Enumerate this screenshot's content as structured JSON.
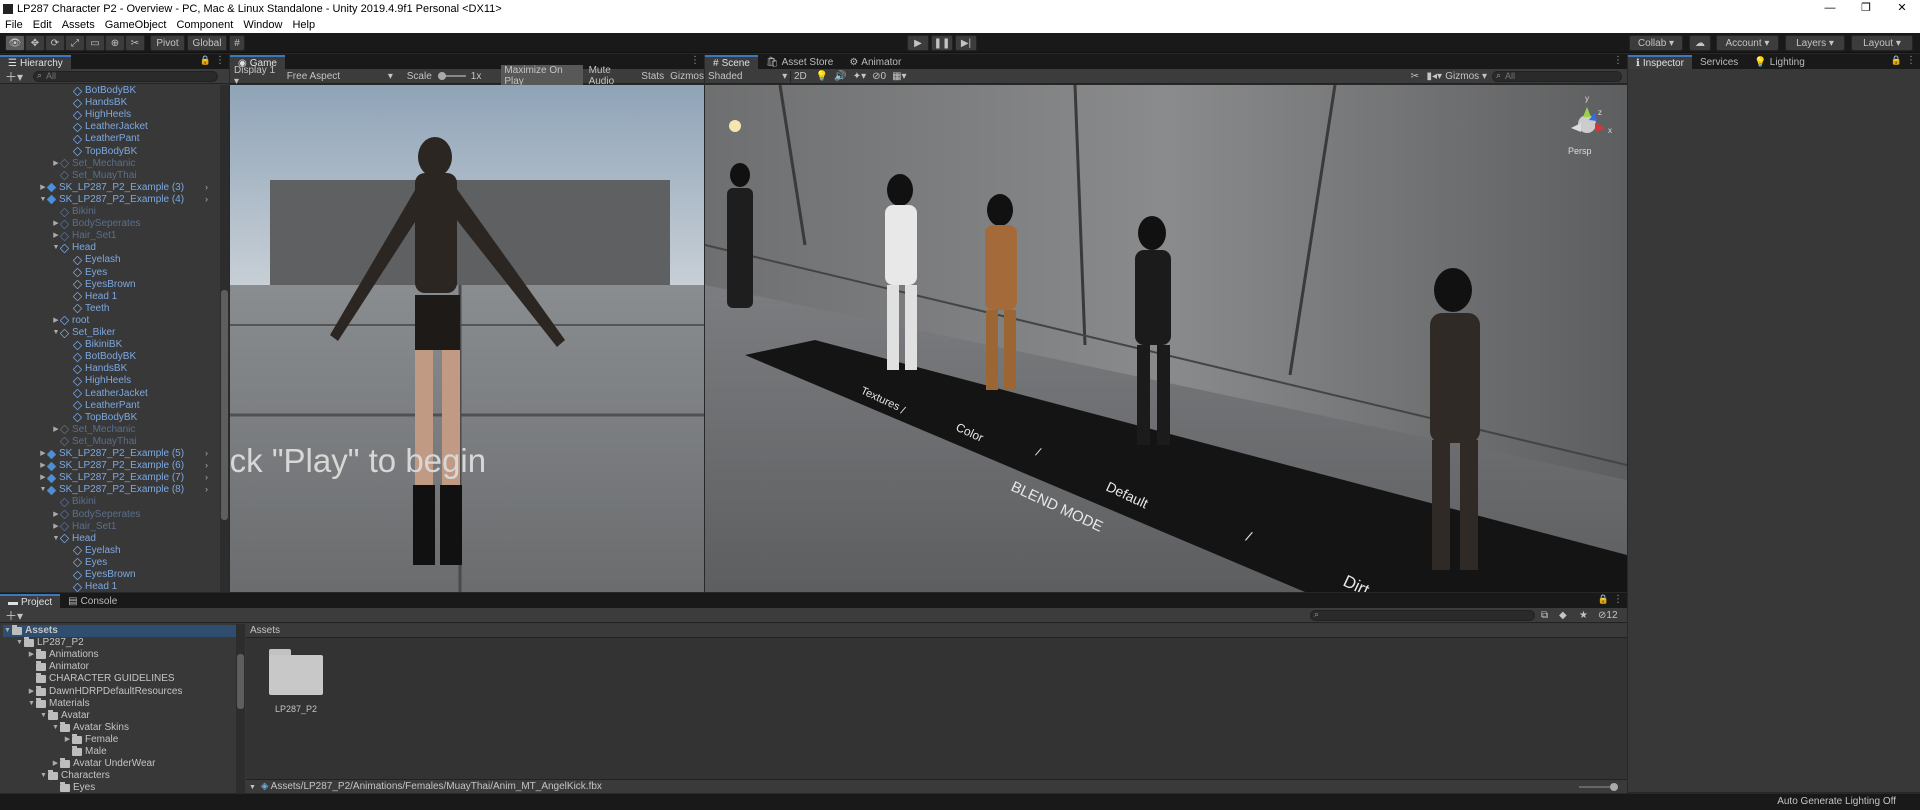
{
  "window": {
    "title": "LP287 Character P2 - Overview - PC, Mac & Linux Standalone - Unity 2019.4.9f1 Personal <DX11>"
  },
  "menu": [
    "File",
    "Edit",
    "Assets",
    "GameObject",
    "Component",
    "Window",
    "Help"
  ],
  "toolbar": {
    "pivot": "Pivot",
    "global": "Global",
    "collab": "Collab ▾",
    "account": "Account",
    "layers": "Layers",
    "layout": "Layout"
  },
  "hierarchy": {
    "tab": "Hierarchy",
    "search_placeholder": "All",
    "rows": [
      {
        "label": "BotBodyBK",
        "indent": 3,
        "arrow": "",
        "style": "prefab"
      },
      {
        "label": "HandsBK",
        "indent": 3,
        "arrow": "",
        "style": "prefab"
      },
      {
        "label": "HighHeels",
        "indent": 3,
        "arrow": "",
        "style": "prefab"
      },
      {
        "label": "LeatherJacket",
        "indent": 3,
        "arrow": "",
        "style": "prefab"
      },
      {
        "label": "LeatherPant",
        "indent": 3,
        "arrow": "",
        "style": "prefab"
      },
      {
        "label": "TopBodyBK",
        "indent": 3,
        "arrow": "",
        "style": "prefab"
      },
      {
        "label": "Set_Mechanic",
        "indent": 2,
        "arrow": "▶",
        "style": "disabled"
      },
      {
        "label": "Set_MuayThai",
        "indent": 2,
        "arrow": "",
        "style": "disabled"
      },
      {
        "label": "SK_LP287_P2_Example (3)",
        "indent": 1,
        "arrow": "▶",
        "style": "prefab-root",
        "chev": true
      },
      {
        "label": "SK_LP287_P2_Example (4)",
        "indent": 1,
        "arrow": "▼",
        "style": "prefab-root",
        "chev": true
      },
      {
        "label": "Bikini",
        "indent": 2,
        "arrow": "",
        "style": "disabled"
      },
      {
        "label": "BodySeperates",
        "indent": 2,
        "arrow": "▶",
        "style": "disabled"
      },
      {
        "label": "Hair_Set1",
        "indent": 2,
        "arrow": "▶",
        "style": "disabled"
      },
      {
        "label": "Head",
        "indent": 2,
        "arrow": "▼",
        "style": "prefab"
      },
      {
        "label": "Eyelash",
        "indent": 3,
        "arrow": "",
        "style": "prefab"
      },
      {
        "label": "Eyes",
        "indent": 3,
        "arrow": "",
        "style": "prefab"
      },
      {
        "label": "EyesBrown",
        "indent": 3,
        "arrow": "",
        "style": "prefab"
      },
      {
        "label": "Head 1",
        "indent": 3,
        "arrow": "",
        "style": "prefab"
      },
      {
        "label": "Teeth",
        "indent": 3,
        "arrow": "",
        "style": "prefab"
      },
      {
        "label": "root",
        "indent": 2,
        "arrow": "▶",
        "style": "prefab"
      },
      {
        "label": "Set_Biker",
        "indent": 2,
        "arrow": "▼",
        "style": "prefab"
      },
      {
        "label": "BikiniBK",
        "indent": 3,
        "arrow": "",
        "style": "prefab"
      },
      {
        "label": "BotBodyBK",
        "indent": 3,
        "arrow": "",
        "style": "prefab"
      },
      {
        "label": "HandsBK",
        "indent": 3,
        "arrow": "",
        "style": "prefab"
      },
      {
        "label": "HighHeels",
        "indent": 3,
        "arrow": "",
        "style": "prefab"
      },
      {
        "label": "LeatherJacket",
        "indent": 3,
        "arrow": "",
        "style": "prefab"
      },
      {
        "label": "LeatherPant",
        "indent": 3,
        "arrow": "",
        "style": "prefab"
      },
      {
        "label": "TopBodyBK",
        "indent": 3,
        "arrow": "",
        "style": "prefab"
      },
      {
        "label": "Set_Mechanic",
        "indent": 2,
        "arrow": "▶",
        "style": "disabled"
      },
      {
        "label": "Set_MuayThai",
        "indent": 2,
        "arrow": "",
        "style": "disabled"
      },
      {
        "label": "SK_LP287_P2_Example (5)",
        "indent": 1,
        "arrow": "▶",
        "style": "prefab-root",
        "chev": true
      },
      {
        "label": "SK_LP287_P2_Example (6)",
        "indent": 1,
        "arrow": "▶",
        "style": "prefab-root",
        "chev": true
      },
      {
        "label": "SK_LP287_P2_Example (7)",
        "indent": 1,
        "arrow": "▶",
        "style": "prefab-root",
        "chev": true
      },
      {
        "label": "SK_LP287_P2_Example (8)",
        "indent": 1,
        "arrow": "▼",
        "style": "prefab-root",
        "chev": true
      },
      {
        "label": "Bikini",
        "indent": 2,
        "arrow": "",
        "style": "disabled"
      },
      {
        "label": "BodySeperates",
        "indent": 2,
        "arrow": "▶",
        "style": "disabled"
      },
      {
        "label": "Hair_Set1",
        "indent": 2,
        "arrow": "▶",
        "style": "disabled"
      },
      {
        "label": "Head",
        "indent": 2,
        "arrow": "▼",
        "style": "prefab"
      },
      {
        "label": "Eyelash",
        "indent": 3,
        "arrow": "",
        "style": "prefab"
      },
      {
        "label": "Eyes",
        "indent": 3,
        "arrow": "",
        "style": "prefab"
      },
      {
        "label": "EyesBrown",
        "indent": 3,
        "arrow": "",
        "style": "prefab"
      },
      {
        "label": "Head 1",
        "indent": 3,
        "arrow": "",
        "style": "prefab"
      }
    ]
  },
  "game": {
    "tab": "Game",
    "display": "Display 1",
    "aspect": "Free Aspect",
    "scale_label": "Scale",
    "scale_value": "1x",
    "maximize": "Maximize On Play",
    "mute": "Mute Audio",
    "stats": "Stats",
    "gizmos": "Gizmos",
    "overlay_text": "lick \"Play\" to begin"
  },
  "scene": {
    "tabs": [
      "Scene",
      "Asset Store",
      "Animator"
    ],
    "shading": "Shaded",
    "mode_2d": "2D",
    "fx_count": "0",
    "gizmos": "Gizmos",
    "search_placeholder": "All",
    "persp": "Persp",
    "floor_words": [
      "Textures",
      "/",
      "Color",
      "/",
      "BLEND MODE",
      "Default",
      "/",
      "Dirt"
    ]
  },
  "inspector": {
    "tabs": [
      "Inspector",
      "Services",
      "Lighting"
    ]
  },
  "project": {
    "tabs": [
      "Project",
      "Console"
    ],
    "hidden_count": "12",
    "tree": [
      {
        "label": "Assets",
        "indent": 0,
        "arrow": "▼",
        "bold": true
      },
      {
        "label": "LP287_P2",
        "indent": 1,
        "arrow": "▼"
      },
      {
        "label": "Animations",
        "indent": 2,
        "arrow": "▶"
      },
      {
        "label": "Animator",
        "indent": 2,
        "arrow": ""
      },
      {
        "label": "CHARACTER GUIDELINES",
        "indent": 2,
        "arrow": ""
      },
      {
        "label": "DawnHDRPDefaultResources",
        "indent": 2,
        "arrow": "▶"
      },
      {
        "label": "Materials",
        "indent": 2,
        "arrow": "▼"
      },
      {
        "label": "Avatar",
        "indent": 3,
        "arrow": "▼"
      },
      {
        "label": "Avatar Skins",
        "indent": 4,
        "arrow": "▼"
      },
      {
        "label": "Female",
        "indent": 5,
        "arrow": "▶"
      },
      {
        "label": "Male",
        "indent": 5,
        "arrow": ""
      },
      {
        "label": "Avatar UnderWear",
        "indent": 4,
        "arrow": "▶"
      },
      {
        "label": "Characters",
        "indent": 3,
        "arrow": "▼"
      },
      {
        "label": "Eyes",
        "indent": 4,
        "arrow": ""
      }
    ],
    "breadcrumb": "Assets",
    "grid_item": "LP287_P2",
    "path": "Assets/LP287_P2/Animations/Females/MuayThai/Anim_MT_AngelKick.fbx"
  },
  "status": {
    "right": "Auto Generate Lighting Off"
  },
  "colors": {
    "accent": "#3a79bb",
    "prefab": "#7ca8e0",
    "disabled": "#5a6f8c"
  }
}
